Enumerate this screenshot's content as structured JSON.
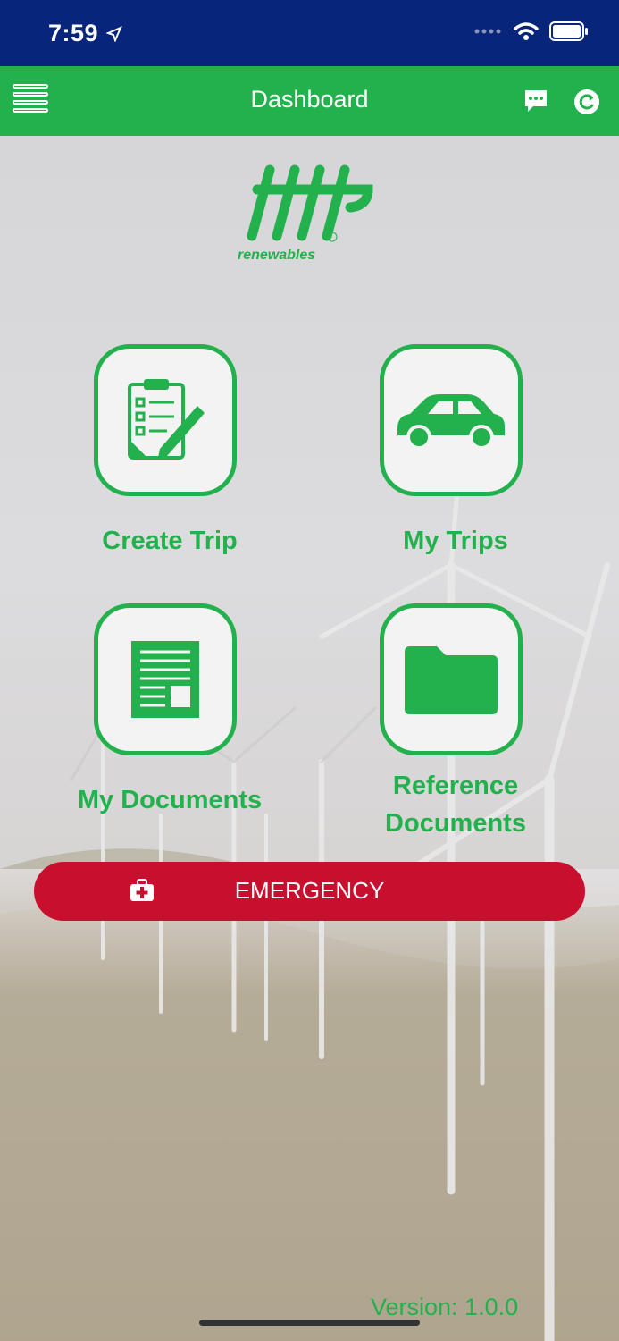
{
  "status_bar": {
    "time": "7:59"
  },
  "header": {
    "title": "Dashboard"
  },
  "logo": {
    "text": "tilt",
    "sub_text": "renewables",
    "tm": "TM"
  },
  "tiles": [
    {
      "label": "Create Trip",
      "icon": "clipboard-pen-icon"
    },
    {
      "label": "My Trips",
      "icon": "car-icon"
    },
    {
      "label": "My Documents",
      "icon": "document-icon"
    },
    {
      "label": "Reference Documents",
      "icon": "folder-icon"
    }
  ],
  "emergency": {
    "label": "EMERGENCY",
    "icon": "medical-kit-icon"
  },
  "footer": {
    "version": "Version: 1.0.0"
  },
  "colors": {
    "brand_green": "#23b14d",
    "status_blue": "#07257a",
    "emergency_red": "#c8102e"
  }
}
